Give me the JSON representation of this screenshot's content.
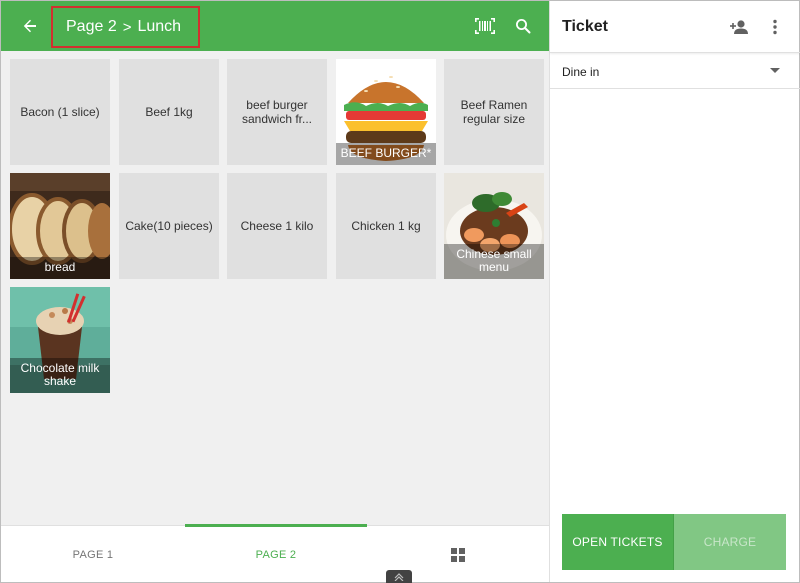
{
  "header": {
    "breadcrumb_page": "Page 2",
    "breadcrumb_sep": ">",
    "breadcrumb_category": "Lunch"
  },
  "items": [
    {
      "label": "Bacon (1 slice)"
    },
    {
      "label": "Beef 1kg"
    },
    {
      "label": "beef burger sandwich fr..."
    },
    {
      "label": "BEEF BURGER*",
      "image": "burger"
    },
    {
      "label": "Beef Ramen regular size"
    },
    {
      "label": "bread",
      "image": "bread"
    },
    {
      "label": "Cake(10 pieces)"
    },
    {
      "label": "Cheese 1 kilo"
    },
    {
      "label": "Chicken 1 kg"
    },
    {
      "label": "Chinese small menu",
      "image": "chinese"
    },
    {
      "label": "Chocolate milk shake",
      "image": "milkshake"
    }
  ],
  "tabs": [
    {
      "label": "PAGE 1"
    },
    {
      "label": "PAGE 2"
    }
  ],
  "ticket": {
    "title": "Ticket",
    "dining_option": "Dine in",
    "open_tickets_label": "OPEN TICKETS",
    "charge_label": "CHARGE"
  },
  "colors": {
    "primary": "#4caf50",
    "primary_light": "#81c784",
    "tile_bg": "#e0e0e0",
    "highlight": "#d32f2f"
  }
}
